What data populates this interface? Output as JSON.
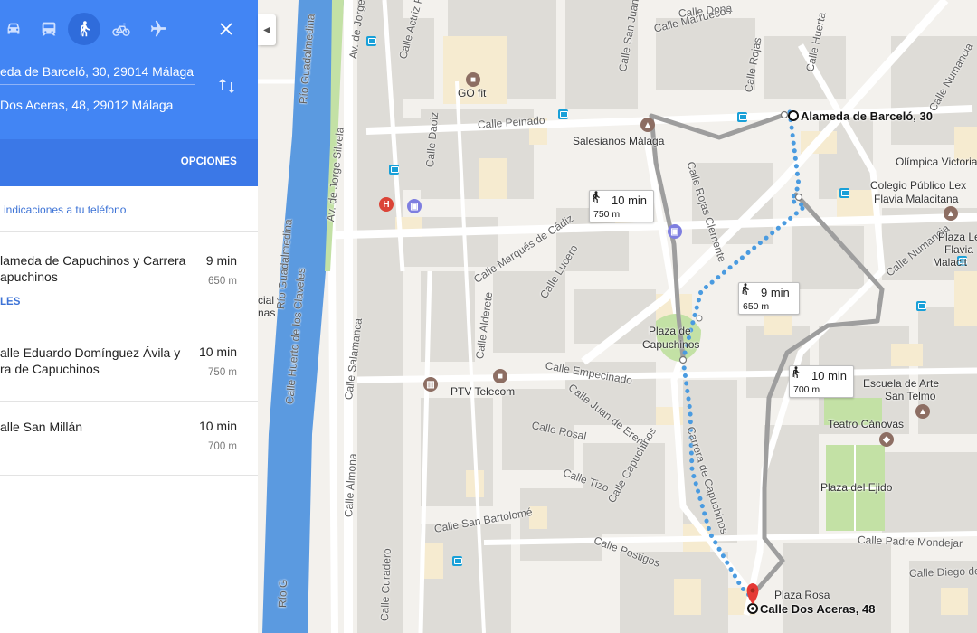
{
  "panel": {
    "travel_modes": [
      {
        "name": "car-icon",
        "active": false
      },
      {
        "name": "transit-icon",
        "active": false
      },
      {
        "name": "walk-icon",
        "active": true
      },
      {
        "name": "bicycle-icon",
        "active": false
      },
      {
        "name": "flight-icon",
        "active": false
      }
    ],
    "close_label": "✕",
    "origin_value": "eda de Barceló, 30, 29014 Málaga",
    "destination_value": "Dos Aceras, 48, 29012 Málaga",
    "options_label": "OPCIONES",
    "send_to_phone": "indicaciones a tu teléfono",
    "routes": [
      {
        "name_line1": "lameda de Capuchinos y Carrera",
        "name_line2": "apuchinos",
        "time": "9 min",
        "distance": "650 m",
        "details": "LES"
      },
      {
        "name_line1": "alle Eduardo Domínguez Ávila y",
        "name_line2": "ra de Capuchinos",
        "time": "10 min",
        "distance": "750 m",
        "details": ""
      },
      {
        "name_line1": "alle San Millán",
        "name_line2": "",
        "time": "10 min",
        "distance": "700 m",
        "details": ""
      }
    ]
  },
  "map": {
    "colors": {
      "water": "#5b9ae0",
      "route_selected": "#4a9be0",
      "route_alt": "#9e9e9e",
      "block": "#d9d7d2",
      "building": "#f7eed9",
      "park": "#c3e1a5",
      "road": "#ffffff"
    },
    "street_labels": {
      "rio1": "Río Guadalmedina",
      "rio2": "Río Guadalmedina",
      "rio3": "Río G",
      "silvela1": "Av. de Jorge Silvela",
      "silvela2": "Av. de Jorge Silvela",
      "huerto": "Calle Huerto de los Claveles",
      "salamanca": "Calle Salamanca",
      "curadero": "Calle Curadero",
      "almona": "Calle Almona",
      "actriz": "Calle Actriz Pepa",
      "sanjuan": "Calle San Juan Bosco",
      "dona": "Calle Dona",
      "marruecos": "Calle Marruecos",
      "rojas": "Calle Rojas",
      "huerta": "Calle Huerta",
      "peinado": "Calle Peinado",
      "daoiz": "Calle Daoiz",
      "cadiz": "Calle Marqués de Cádiz",
      "lucero": "Calle Lucero",
      "alderete": "Calle Alderete",
      "rojasclemente": "Calle Rojas Clemente",
      "empecinado": "Calle Empecinado",
      "juanerena": "Calle Juan de Erena",
      "rosal": "Calle Rosal",
      "capuchinos": "Calle Capuchinos",
      "carrera": "Carrera de Capuchinos",
      "tizo": "Calle Tizo",
      "bartolome": "Calle San Bartolomé",
      "postigos": "Calle Postigos",
      "padre": "Calle Padre Mondejar",
      "diego": "Calle Diego de",
      "numancia1": "Calle Numancia",
      "numancia2": "Calle Numancia"
    },
    "place_labels": {
      "gofit": "GO fit",
      "salesianos": "Salesianos Málaga",
      "ptv": "PTV Telecom",
      "plaza_cap1": "Plaza de",
      "plaza_cap2": "Capuchinos",
      "olimpica": "Olímpica Victoria",
      "colegio1": "Colegio Público Lex",
      "colegio2": "Flavia Malacitana",
      "plazale1": "Plaza Le",
      "plazale2": "Flavia",
      "plazale3": "Malacit",
      "escuela1": "Escuela de Arte",
      "escuela2": "San Telmo",
      "teatro": "Teatro Cánovas",
      "ejido": "Plaza del Ejido",
      "rosa": "Plaza Rosa",
      "cial1": "cial",
      "cial2": "nas"
    },
    "endpoints": {
      "origin": "Alameda de Barceló, 30",
      "destination": "Calle Dos Aceras, 48"
    },
    "time_boxes": [
      {
        "time": "10 min",
        "distance": "750 m"
      },
      {
        "time": "9 min",
        "distance": "650 m"
      },
      {
        "time": "10 min",
        "distance": "700 m"
      }
    ]
  }
}
